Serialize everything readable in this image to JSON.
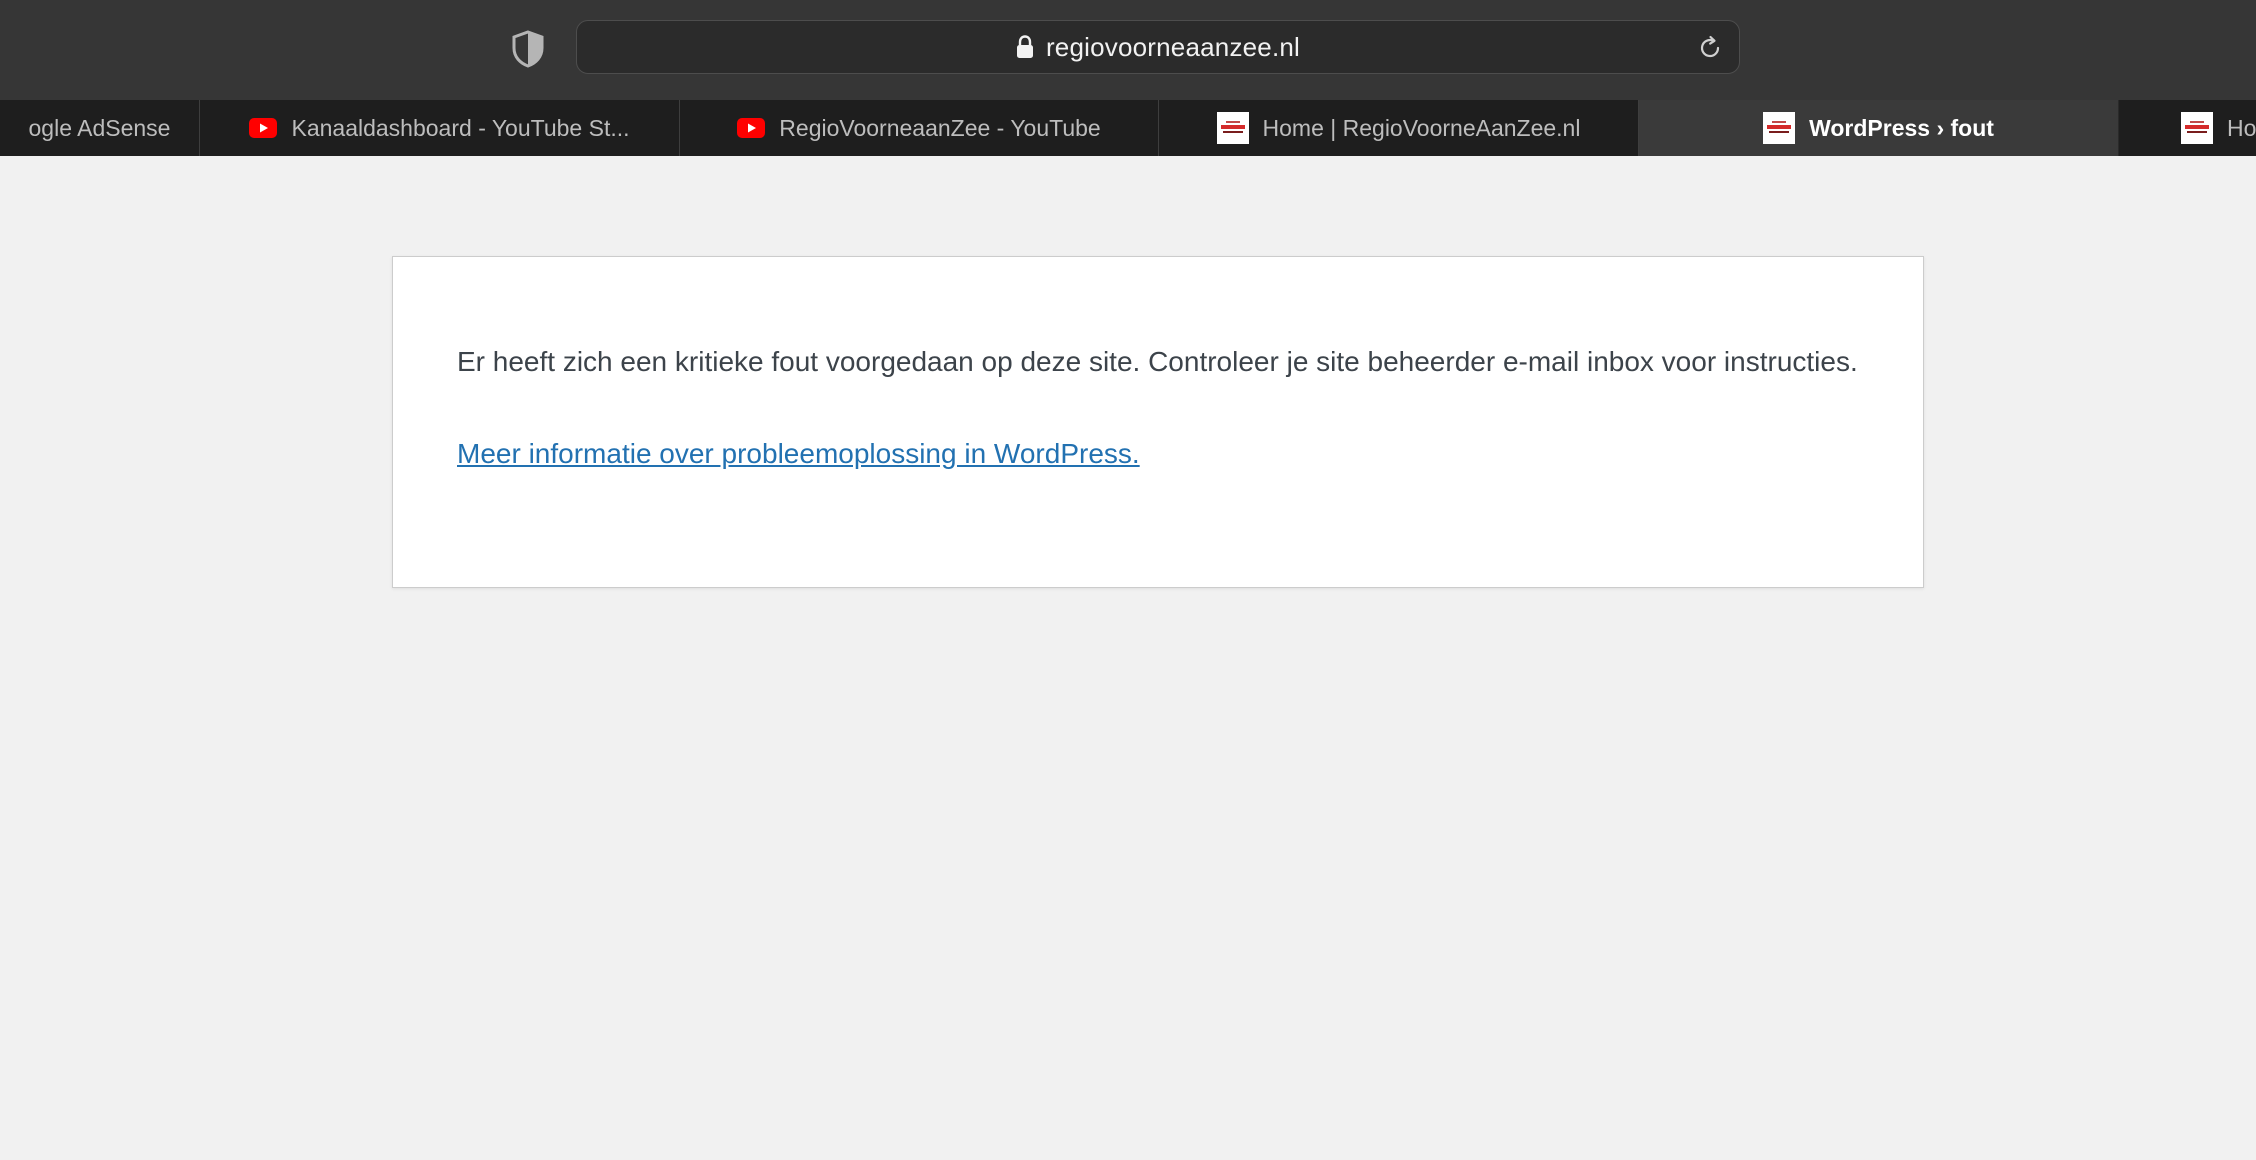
{
  "browser": {
    "url": "regiovoorneaanzee.nl",
    "tabs": [
      {
        "label": "ogle AdSense",
        "icon": "none"
      },
      {
        "label": "Kanaaldashboard - YouTube St...",
        "icon": "youtube-icon"
      },
      {
        "label": "RegioVoorneaanZee - YouTube",
        "icon": "youtube-icon"
      },
      {
        "label": "Home | RegioVoorneAanZee.nl",
        "icon": "site-favicon-icon"
      },
      {
        "label": "WordPress › fout",
        "icon": "site-favicon-icon",
        "active": true
      },
      {
        "label": "Hor",
        "icon": "site-favicon-icon"
      }
    ]
  },
  "page": {
    "message": "Er heeft zich een kritieke fout voorgedaan op deze site. Controleer je site beheerder e-mail inbox voor instructies.",
    "link_text": "Meer informatie over probleemoplossing in WordPress."
  },
  "colors": {
    "toolbar": "#363636",
    "tabbar": "#1e1e1e",
    "active_tab": "#3a3a3a",
    "page_background": "#f1f1f1",
    "link": "#2271b1",
    "youtube_red": "#ff0000"
  }
}
